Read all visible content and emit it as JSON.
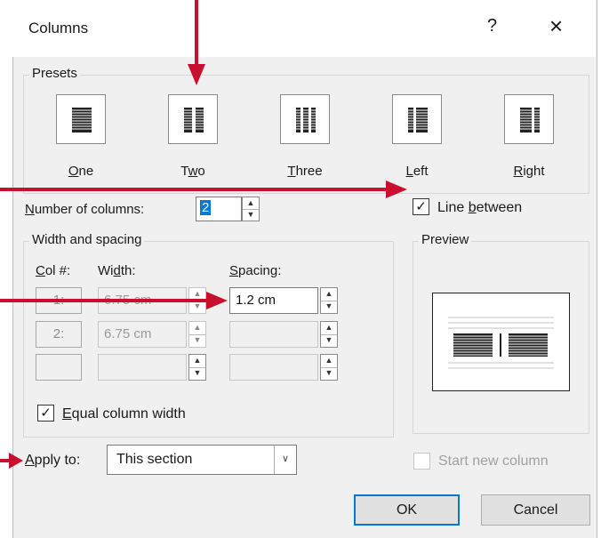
{
  "dialog": {
    "title": "Columns",
    "help_glyph": "?",
    "close_glyph": "×"
  },
  "presets": {
    "group_label": "Presets",
    "items": [
      {
        "label": "One",
        "accel": "O",
        "rest": "ne",
        "icon": "one-column-icon"
      },
      {
        "label": "Two",
        "accel": "w",
        "pre": "T",
        "rest": "o",
        "icon": "two-columns-icon"
      },
      {
        "label": "Three",
        "accel": "T",
        "rest": "hree",
        "icon": "three-columns-icon"
      },
      {
        "label": "Left",
        "accel": "L",
        "rest": "eft",
        "icon": "left-columns-icon"
      },
      {
        "label": "Right",
        "accel": "R",
        "rest": "ight",
        "icon": "right-columns-icon"
      }
    ]
  },
  "number_of_columns": {
    "label_accel": "N",
    "label_rest": "umber of columns:",
    "value": "2"
  },
  "line_between": {
    "label_pre": "Line ",
    "label_accel": "b",
    "label_rest": "etween",
    "checked": true
  },
  "width_spacing": {
    "group_label": "Width and spacing",
    "col_header_accel": "C",
    "col_header_rest": "ol #:",
    "width_header_pre": "Wi",
    "width_header_accel": "d",
    "width_header_rest": "th:",
    "spacing_header_accel": "S",
    "spacing_header_rest": "pacing:",
    "rows": [
      {
        "col": "1:",
        "width": "6.75 cm",
        "spacing": "1.2 cm"
      },
      {
        "col": "2:",
        "width": "6.75 cm",
        "spacing": ""
      },
      {
        "col": "",
        "width": "",
        "spacing": ""
      }
    ]
  },
  "equal_width": {
    "label_accel": "E",
    "label_rest": "qual column width",
    "checked": true
  },
  "preview": {
    "group_label": "Preview"
  },
  "apply_to": {
    "label_accel": "A",
    "label_rest": "pply to:",
    "value": "This section"
  },
  "start_new_column": {
    "label": "Start new column",
    "checked": false
  },
  "buttons": {
    "ok": "OK",
    "cancel": "Cancel"
  },
  "annotation_color": "#c8102e",
  "check_glyph": "✓",
  "spin_up_glyph": "▲",
  "spin_down_glyph": "▼",
  "dropdown_glyph": "∨"
}
